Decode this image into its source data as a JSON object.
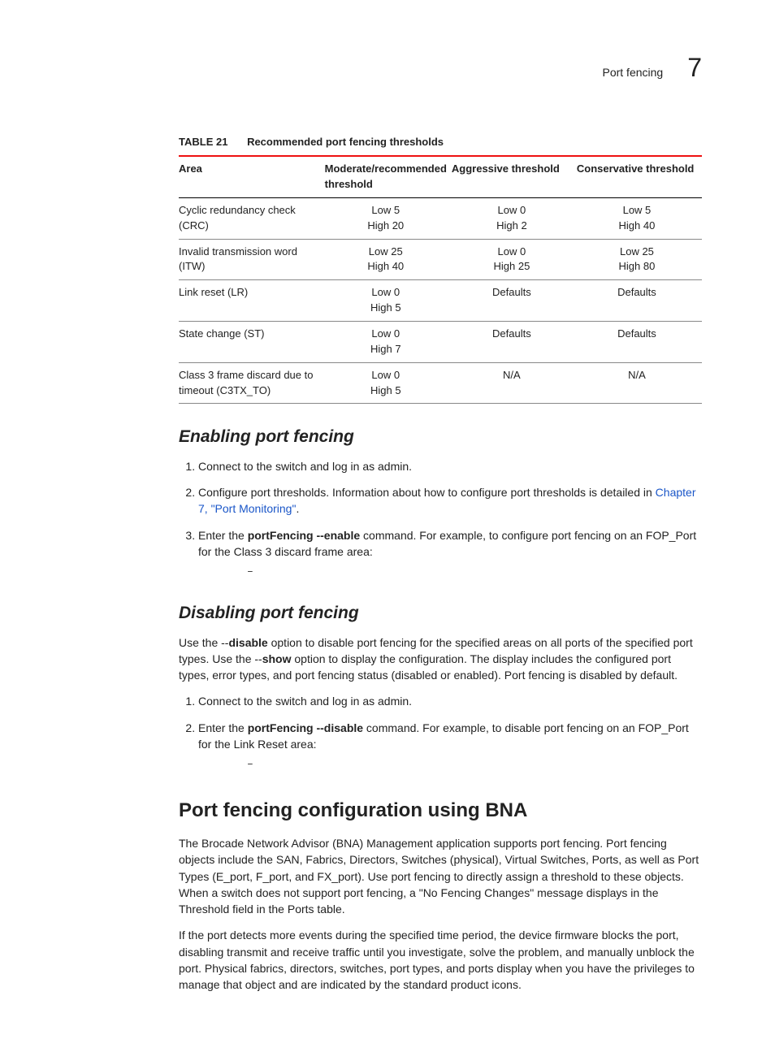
{
  "header": {
    "running_title": "Port fencing",
    "chapter_number": "7"
  },
  "table": {
    "label": "TABLE 21",
    "caption": "Recommended port fencing thresholds",
    "headers": {
      "area": "Area",
      "moderate": "Moderate/recommended threshold",
      "aggressive": "Aggressive threshold",
      "conservative": "Conservative threshold"
    },
    "rows": [
      {
        "area": "Cyclic redundancy check (CRC)",
        "moderate_low": "Low 5",
        "moderate_high": "High 20",
        "aggressive_low": "Low 0",
        "aggressive_high": "High 2",
        "conservative_low": "Low 5",
        "conservative_high": "High 40"
      },
      {
        "area": "Invalid transmission word (ITW)",
        "moderate_low": "Low 25",
        "moderate_high": "High 40",
        "aggressive_low": "Low 0",
        "aggressive_high": "High 25",
        "conservative_low": "Low 25",
        "conservative_high": "High 80"
      },
      {
        "area": "Link reset (LR)",
        "moderate_low": "Low 0",
        "moderate_high": "High 5",
        "aggressive_low": "Defaults",
        "aggressive_high": "",
        "conservative_low": "Defaults",
        "conservative_high": ""
      },
      {
        "area": "State change (ST)",
        "moderate_low": "Low 0",
        "moderate_high": "High 7",
        "aggressive_low": "Defaults",
        "aggressive_high": "",
        "conservative_low": "Defaults",
        "conservative_high": ""
      },
      {
        "area": "Class 3 frame discard due to timeout (C3TX_TO)",
        "moderate_low": "Low 0",
        "moderate_high": "High 5",
        "aggressive_low": "N/A",
        "aggressive_high": "",
        "conservative_low": "N/A",
        "conservative_high": ""
      }
    ]
  },
  "enabling": {
    "heading": "Enabling port fencing",
    "step1": "Connect to the switch and log in as admin.",
    "step2_a": "Configure port thresholds. Information about how to configure port thresholds is detailed in ",
    "step2_link": "Chapter 7, \"Port Monitoring\"",
    "step2_b": ".",
    "step3_a": "Enter the ",
    "step3_cmd": "portFencing --enable",
    "step3_b": " command. For example, to configure port fencing on an FOP_Port for the Class 3 discard frame area:",
    "code": "–"
  },
  "disabling": {
    "heading": "Disabling port fencing",
    "intro_a": "Use the --",
    "intro_b": "disable",
    "intro_c": " option to disable port fencing for the specified areas on all ports of the specified port types. Use the --",
    "intro_d": "show",
    "intro_e": " option to display the configuration. The display includes the configured port types, error types, and port fencing status (disabled or enabled). Port fencing is disabled by default.",
    "step1": "Connect to the switch and log in as admin.",
    "step2_a": "Enter the ",
    "step2_cmd": "portFencing --disable",
    "step2_b": " command. For example, to disable port fencing on an FOP_Port for the Link Reset area:",
    "code": "–"
  },
  "bna": {
    "heading": "Port fencing configuration using BNA",
    "p1": "The Brocade Network Advisor (BNA) Management application supports port fencing. Port fencing objects include the SAN, Fabrics, Directors, Switches (physical), Virtual Switches, Ports, as well as Port Types (E_port, F_port, and FX_port). Use port fencing to directly assign a threshold to these objects. When a switch does not support port fencing, a \"No Fencing Changes\" message displays in the Threshold field in the Ports table.",
    "p2": "If the port detects more events during the specified time period, the device firmware blocks the port, disabling transmit and receive traffic until you investigate, solve the problem, and manually unblock the port. Physical fabrics, directors, switches, port types, and ports display when you have the privileges to manage that object and are indicated by the standard product icons."
  }
}
